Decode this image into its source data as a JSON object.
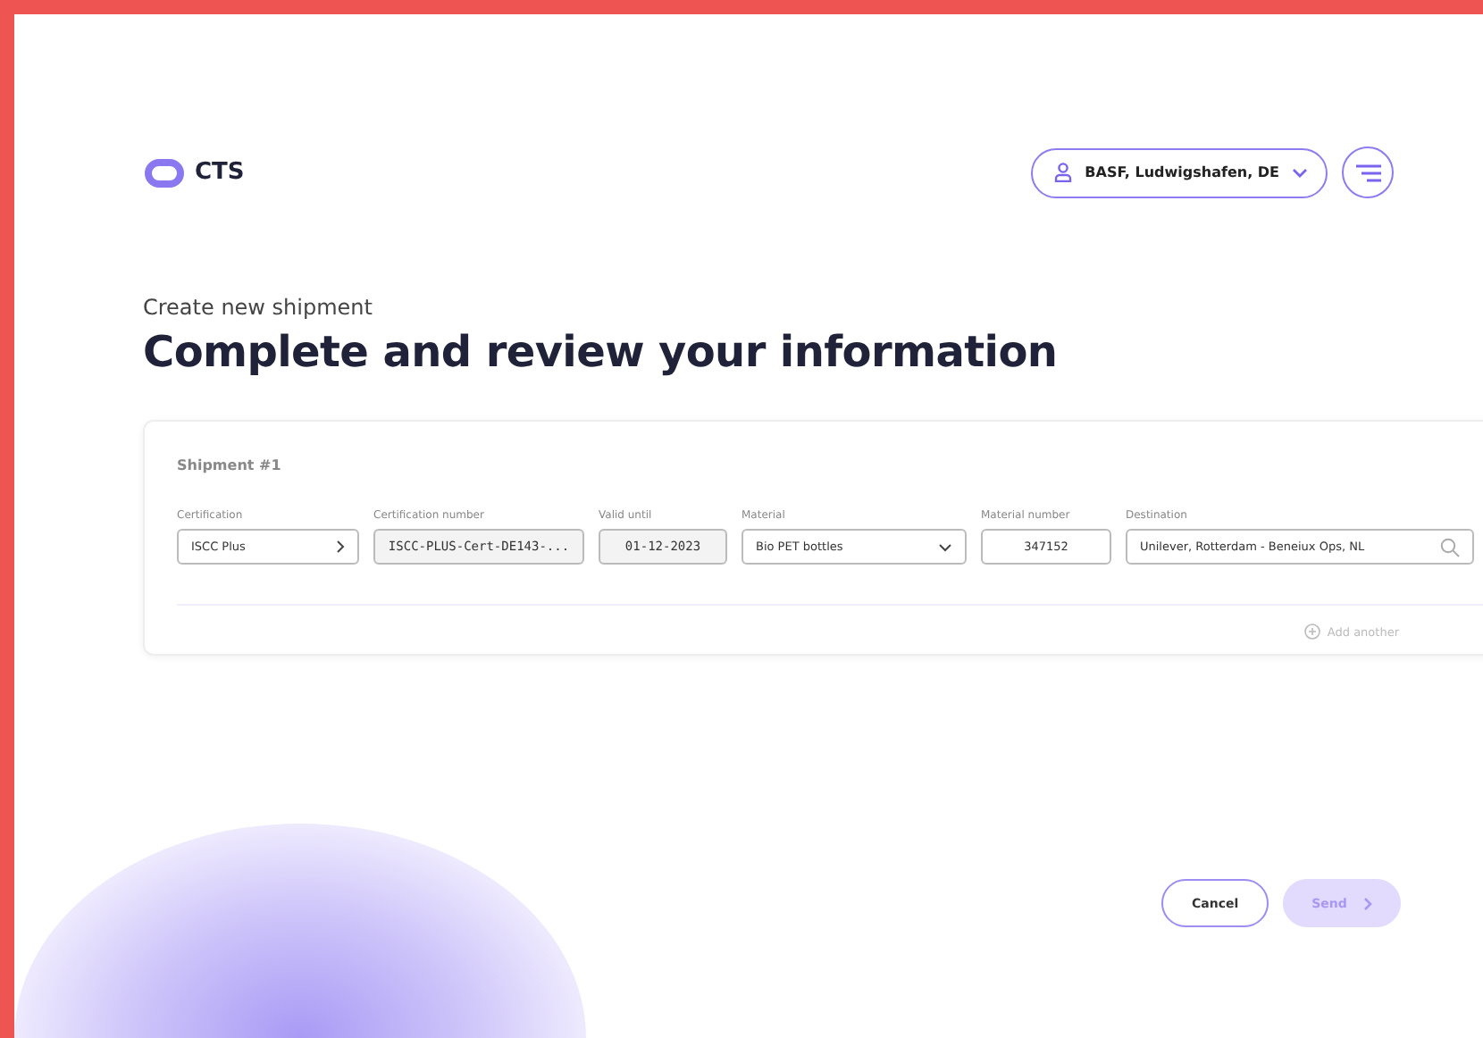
{
  "header": {
    "logo": "CTS",
    "account": "BASF, Ludwigshafen, DE"
  },
  "subtitle": "Create new shipment",
  "title": "Complete and review your information",
  "shipment": {
    "title": "Shipment #1",
    "fields": [
      {
        "label": "Certification",
        "value": "ISCC Plus",
        "kind": "picker"
      },
      {
        "label": "Certification number",
        "value": "ISCC-PLUS-Cert-DE143-...",
        "kind": "readonly"
      },
      {
        "label": "Valid until",
        "value": "01-12-2023",
        "kind": "readonly"
      },
      {
        "label": "Material",
        "value": "Bio PET bottles",
        "kind": "dropdown"
      },
      {
        "label": "Material number",
        "value": "347152",
        "kind": "input"
      },
      {
        "label": "Destination",
        "value": "Unilever, Rotterdam - Beneiux Ops, NL",
        "kind": "search"
      }
    ],
    "add": "Add another"
  },
  "buttons": [
    {
      "label": "Cancel",
      "kind": "secondary",
      "disabled": false
    },
    {
      "label": "Send",
      "kind": "primary",
      "disabled": true
    }
  ]
}
